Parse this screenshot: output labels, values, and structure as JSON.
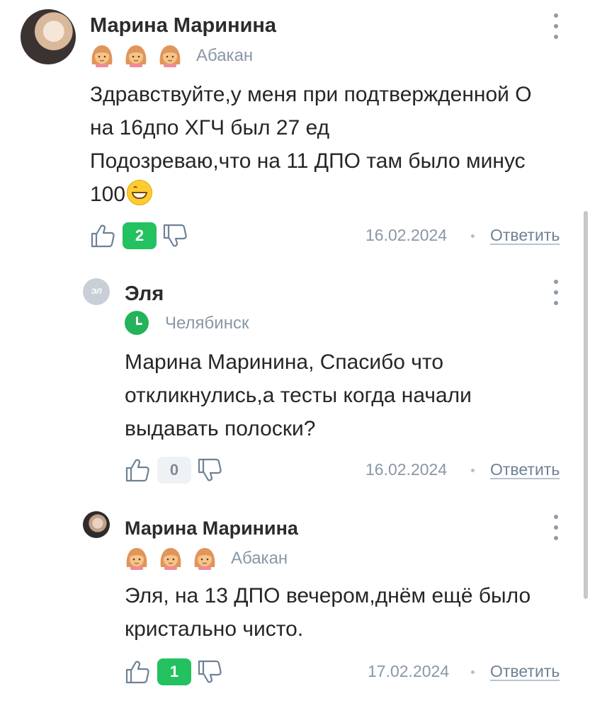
{
  "comments": [
    {
      "author": "Марина Маринина",
      "city": "Абакан",
      "badge_icons": [
        "girl-face-icon",
        "girl-face-icon",
        "girl-face-icon"
      ],
      "text_lines": [
        "Здравствуйте,у меня при подтвержденной О",
        "на 16дпо ХГЧ был 27 ед",
        "Подозреваю,что на 11 ДПО там было минус",
        "100"
      ],
      "emoji": "grinning-face-icon",
      "likes": "2",
      "date": "16.02.2024",
      "reply_label": "Ответить"
    },
    {
      "author": "Эля",
      "avatar_initials": "ЭЛ",
      "city": "Челябинск",
      "status_icon": "clock-icon",
      "text_lines": [
        "Марина Маринина, Спасибо что",
        "откликнулись,а тесты когда начали",
        "выдавать полоски?"
      ],
      "likes": "0",
      "date": "16.02.2024",
      "reply_label": "Ответить"
    },
    {
      "author": "Марина Маринина",
      "city": "Абакан",
      "badge_icons": [
        "girl-face-icon",
        "girl-face-icon",
        "girl-face-icon"
      ],
      "text_lines": [
        "Эля, на 13 ДПО вечером,днём ещё было",
        "кристально чисто."
      ],
      "likes": "1",
      "date": "17.02.2024",
      "reply_label": "Ответить"
    }
  ],
  "colors": {
    "like_active": "#23c160",
    "like_zero_bg": "#eef2f5",
    "muted": "#8a97a6",
    "link": "#6f8196"
  }
}
